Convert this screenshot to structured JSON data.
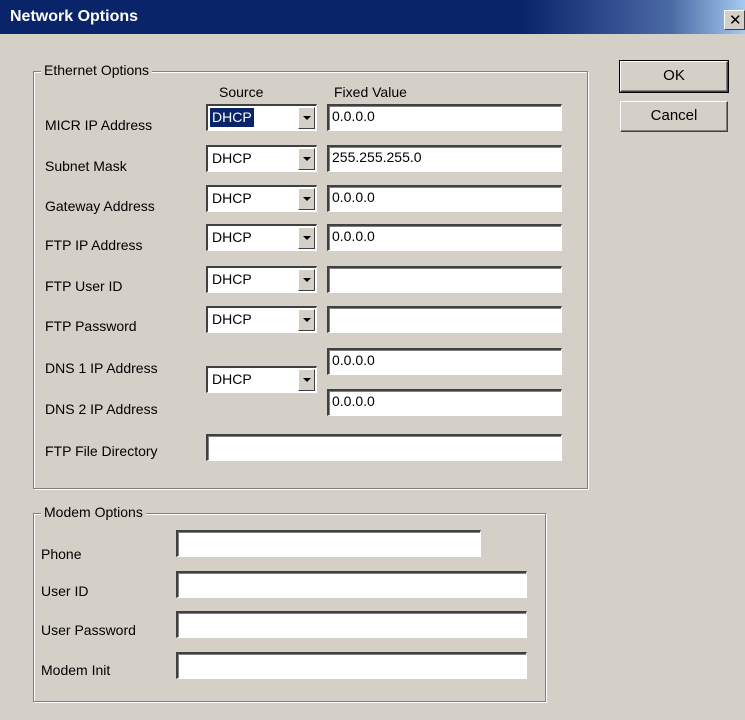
{
  "window": {
    "title": "Network Options",
    "close_glyph": "✕"
  },
  "ethernet": {
    "legend": "Ethernet Options",
    "col_source": "Source",
    "col_fixed": "Fixed Value",
    "rows": [
      {
        "label": "MICR IP Address",
        "source": "DHCP",
        "value": "0.0.0.0"
      },
      {
        "label": "Subnet Mask",
        "source": "DHCP",
        "value": "255.255.255.0"
      },
      {
        "label": "Gateway Address",
        "source": "DHCP",
        "value": "0.0.0.0"
      },
      {
        "label": "FTP IP Address",
        "source": "DHCP",
        "value": "0.0.0.0"
      },
      {
        "label": "FTP User ID",
        "source": "DHCP",
        "value": ""
      },
      {
        "label": "FTP Password",
        "source": "DHCP",
        "value": ""
      }
    ],
    "dns": {
      "dns1_label": "DNS 1 IP Address",
      "dns2_label": "DNS 2 IP Address",
      "source": "DHCP",
      "dns1_value": "0.0.0.0",
      "dns2_value": "0.0.0.0"
    },
    "ftp_dir": {
      "label": "FTP File Directory",
      "value": ""
    }
  },
  "modem": {
    "legend": "Modem Options",
    "phone": {
      "label": "Phone",
      "value": ""
    },
    "user_id": {
      "label": "User ID",
      "value": ""
    },
    "user_password": {
      "label": "User Password",
      "value": ""
    },
    "modem_init": {
      "label": "Modem Init",
      "value": ""
    }
  },
  "buttons": {
    "ok": "OK",
    "cancel": "Cancel"
  },
  "colors": {
    "titlebar": "#0a246a",
    "face": "#d4d0c8",
    "selection": "#0a246a"
  }
}
